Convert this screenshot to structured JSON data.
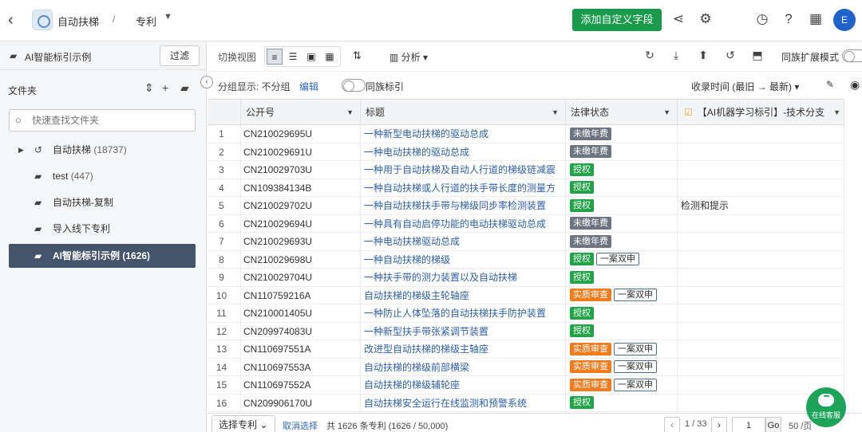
{
  "topbar": {
    "back_icon": "chevron-left-icon",
    "title": "自动扶梯",
    "separator": "/",
    "breadcrumb": "专利",
    "add_field_button": "添加自定义字段",
    "avatar_initial": "E",
    "accent_color": "#1a9b4b"
  },
  "sidebar": {
    "header_label": "AI智能标引示例",
    "filter_button": "过滤",
    "folder_label": "文件夹",
    "search_placeholder": "快速查找文件夹",
    "items": [
      {
        "label": "自动扶梯",
        "count": "(18737)",
        "expandable": true,
        "icon": "history-icon"
      },
      {
        "label": "test",
        "count": "(447)",
        "icon": "folder-icon"
      },
      {
        "label": "自动扶梯-复制",
        "count": "",
        "icon": "folder-icon"
      },
      {
        "label": "导入线下专利",
        "count": "",
        "icon": "folder-icon"
      },
      {
        "label": "AI智能标引示例",
        "count": "(1626)",
        "icon": "folder-open-icon",
        "active": true
      }
    ],
    "active_color": "#44546a"
  },
  "toolbar": {
    "switch_view": "切换视图",
    "analyze": "分析",
    "family_expand": "同族扩展模式"
  },
  "groupbar": {
    "group_display": "分组显示: 不分组",
    "edit": "编辑",
    "family_label": "同族标引",
    "sort": "收录时间 (最旧 → 最新)"
  },
  "table": {
    "headers": [
      "公开号",
      "标题",
      "法律状态",
      "【AI机器学习标引】-技术分支"
    ],
    "rows": [
      {
        "idx": "1",
        "dot": false,
        "pn": "CN210029695U",
        "title": "一种新型电动扶梯的驱动总成",
        "status": [
          {
            "t": "未缴年费",
            "c": "grey"
          }
        ],
        "tech": ""
      },
      {
        "idx": "2",
        "dot": true,
        "pn": "CN210029691U",
        "title": "一种电动扶梯的驱动总成",
        "status": [
          {
            "t": "未缴年费",
            "c": "grey"
          }
        ],
        "tech": ""
      },
      {
        "idx": "3",
        "dot": true,
        "pn": "CN210029703U",
        "title": "一种用于自动扶梯及自动人行道的梯级链减震",
        "status": [
          {
            "t": "授权",
            "c": "green"
          }
        ],
        "tech": ""
      },
      {
        "idx": "4",
        "dot": false,
        "pn": "CN109384134B",
        "title": "一种自动扶梯或人行道的扶手带长度的测量方",
        "status": [
          {
            "t": "授权",
            "c": "green"
          }
        ],
        "tech": ""
      },
      {
        "idx": "5",
        "dot": true,
        "pn": "CN210029702U",
        "title": "一种自动扶梯扶手带与梯级同步率检测装置",
        "status": [
          {
            "t": "授权",
            "c": "green"
          }
        ],
        "tech": "检测和提示"
      },
      {
        "idx": "6",
        "dot": true,
        "pn": "CN210029694U",
        "title": "一种具有自动启停功能的电动扶梯驱动总成",
        "status": [
          {
            "t": "未缴年费",
            "c": "grey"
          }
        ],
        "tech": ""
      },
      {
        "idx": "7",
        "dot": true,
        "pn": "CN210029693U",
        "title": "一种电动扶梯驱动总成",
        "status": [
          {
            "t": "未缴年费",
            "c": "grey"
          }
        ],
        "tech": ""
      },
      {
        "idx": "8",
        "dot": true,
        "pn": "CN210029698U",
        "title": "一种自动扶梯的梯级",
        "status": [
          {
            "t": "授权",
            "c": "green"
          },
          {
            "t": "一案双申",
            "c": "outline"
          }
        ],
        "tech": ""
      },
      {
        "idx": "9",
        "dot": true,
        "pn": "CN210029704U",
        "title": "一种扶手带的测力装置以及自动扶梯",
        "status": [
          {
            "t": "授权",
            "c": "green"
          }
        ],
        "tech": ""
      },
      {
        "idx": "10",
        "dot": true,
        "pn": "CN110759216A",
        "title": "自动扶梯的梯级主轮轴座",
        "status": [
          {
            "t": "实质审查",
            "c": "orange"
          },
          {
            "t": "一案双申",
            "c": "outline"
          }
        ],
        "tech": ""
      },
      {
        "idx": "11",
        "dot": true,
        "pn": "CN210001405U",
        "title": "一种防止人体坠落的自动扶梯扶手防护装置",
        "status": [
          {
            "t": "授权",
            "c": "green"
          }
        ],
        "tech": ""
      },
      {
        "idx": "12",
        "dot": true,
        "pn": "CN209974083U",
        "title": "一种新型扶手带张紧调节装置",
        "status": [
          {
            "t": "授权",
            "c": "green"
          }
        ],
        "tech": ""
      },
      {
        "idx": "13",
        "dot": true,
        "pn": "CN110697551A",
        "title": "改进型自动扶梯的梯级主轴座",
        "status": [
          {
            "t": "实质审查",
            "c": "orange"
          },
          {
            "t": "一案双申",
            "c": "outline"
          }
        ],
        "tech": ""
      },
      {
        "idx": "14",
        "dot": true,
        "pn": "CN110697553A",
        "title": "自动扶梯的梯级前部横梁",
        "status": [
          {
            "t": "实质审查",
            "c": "orange"
          },
          {
            "t": "一案双申",
            "c": "outline"
          }
        ],
        "tech": ""
      },
      {
        "idx": "15",
        "dot": true,
        "pn": "CN110697552A",
        "title": "自动扶梯的梯级辅轮座",
        "status": [
          {
            "t": "实质审查",
            "c": "orange"
          },
          {
            "t": "一案双申",
            "c": "outline"
          }
        ],
        "tech": ""
      },
      {
        "idx": "16",
        "dot": true,
        "pn": "CN209906170U",
        "title": "自动扶梯安全运行在线监测和预警系统",
        "status": [
          {
            "t": "授权",
            "c": "green"
          }
        ],
        "tech": ""
      }
    ]
  },
  "footer": {
    "select_patents": "选择专利",
    "clear_selection": "取消选择",
    "summary": "共 1626 条专利 (1626 / 50,000)",
    "page_info": "1 / 33",
    "page_input": "1",
    "go": "Go",
    "per_page": "50 /页"
  },
  "chat": {
    "label": "在线客服"
  }
}
